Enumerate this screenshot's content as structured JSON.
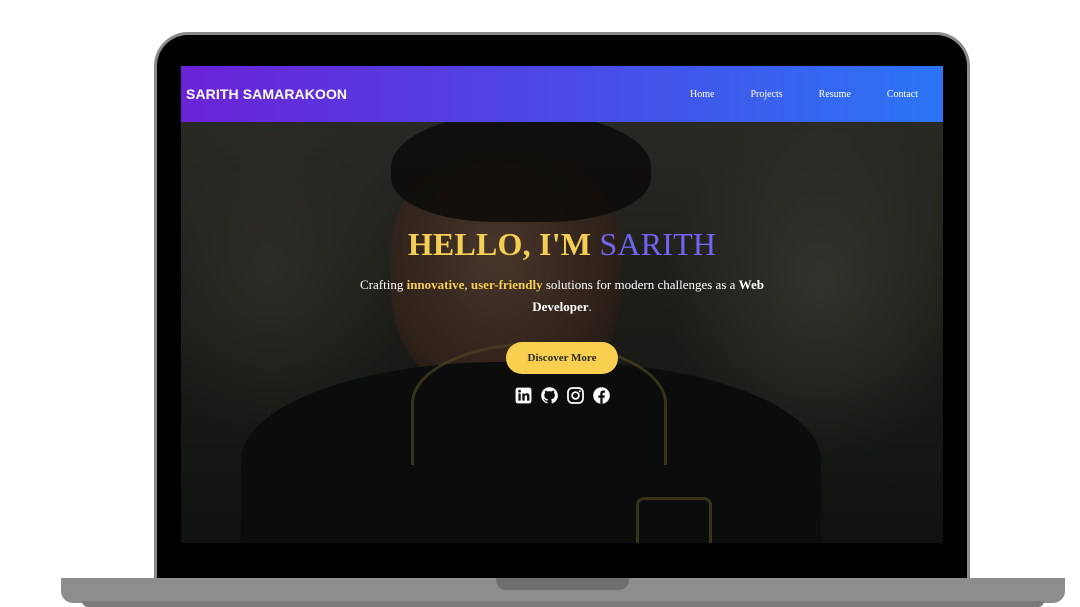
{
  "site": {
    "brand": "SARITH SAMARAKOON"
  },
  "nav": {
    "items": [
      {
        "label": "Home"
      },
      {
        "label": "Projects"
      },
      {
        "label": "Resume"
      },
      {
        "label": "Contact"
      }
    ]
  },
  "hero": {
    "headline_prefix": "HELLO, I'M ",
    "headline_name": "SARITH",
    "tagline": {
      "part1": "Crafting ",
      "highlight1": "innovative",
      "sep": ", ",
      "highlight2": "user-friendly",
      "part2": " solutions for modern challenges as a ",
      "role": "Web Developer",
      "end": "."
    },
    "cta_label": "Discover More",
    "socials": [
      {
        "icon": "linkedin-icon"
      },
      {
        "icon": "github-icon"
      },
      {
        "icon": "instagram-icon"
      },
      {
        "icon": "facebook-icon"
      }
    ]
  },
  "colors": {
    "nav_gradient_start": "#6a23d6",
    "nav_gradient_end": "#2b74f4",
    "accent_yellow": "#f5cf55",
    "accent_purple": "#6f66f2",
    "button_bg": "#f9cf4f"
  }
}
